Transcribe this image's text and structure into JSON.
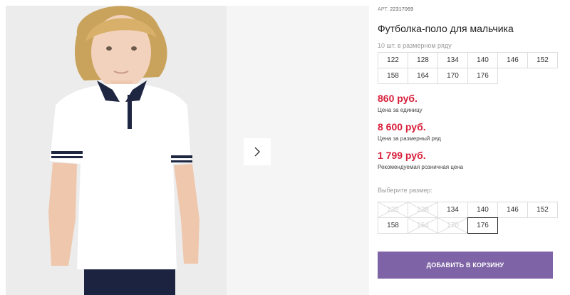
{
  "product": {
    "article_label": "АРТ.",
    "article_number": "22317069",
    "title": "Футболка-поло для мальчика",
    "pack_label": "10 шт. в размерном ряду",
    "pack_sizes": [
      "122",
      "128",
      "134",
      "140",
      "146",
      "152",
      "158",
      "164",
      "170",
      "176"
    ]
  },
  "prices": {
    "unit_price": "860 руб.",
    "unit_label": "Цена за единицу",
    "pack_price": "8 600 руб.",
    "pack_label": "Цена за размерный ряд",
    "retail_price": "1 799 руб.",
    "retail_label": "Рекомендуемая розничная цена"
  },
  "size_selector": {
    "label": "Выберите размер:",
    "sizes": [
      {
        "value": "122",
        "available": false
      },
      {
        "value": "128",
        "available": false
      },
      {
        "value": "134",
        "available": true
      },
      {
        "value": "140",
        "available": true
      },
      {
        "value": "146",
        "available": true
      },
      {
        "value": "152",
        "available": true
      },
      {
        "value": "158",
        "available": true
      },
      {
        "value": "164",
        "available": false
      },
      {
        "value": "170",
        "available": false
      },
      {
        "value": "176",
        "available": true,
        "selected": true
      }
    ]
  },
  "cart": {
    "add_button": "ДОБАВИТЬ В КОРЗИНУ"
  },
  "gallery": {
    "next_icon": "chevron-right-icon"
  },
  "colors": {
    "price": "#d81f3a",
    "button": "#7e64a6",
    "shirt": "#ffffff",
    "collar": "#1e2642"
  }
}
